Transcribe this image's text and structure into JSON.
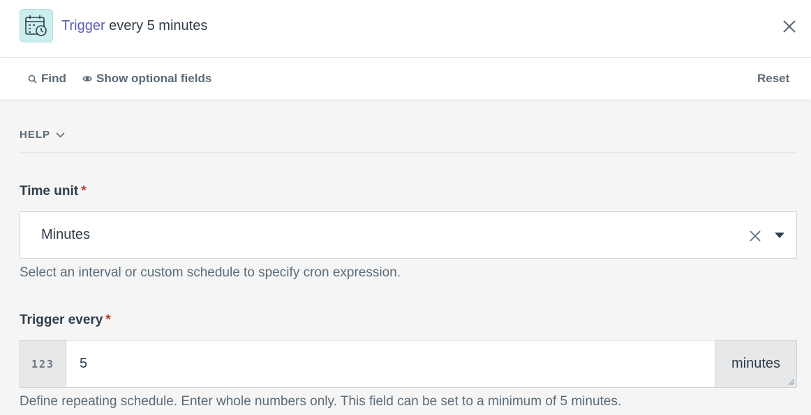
{
  "header": {
    "title_link": "Trigger",
    "title_rest": " every 5 minutes",
    "app_icon": "calendar-clock-icon",
    "close_icon": "close-icon"
  },
  "toolbar": {
    "find_label": "Find",
    "optional_label": "Show optional fields",
    "reset_label": "Reset"
  },
  "help": {
    "label": "HELP"
  },
  "time_unit": {
    "label": "Time unit",
    "required_mark": "*",
    "value": "Minutes",
    "hint": "Select an interval or custom schedule to specify cron expression."
  },
  "trigger_every": {
    "label": "Trigger every",
    "required_mark": "*",
    "prefix": "123",
    "value": "5",
    "suffix": "minutes",
    "hint": "Define repeating schedule. Enter whole numbers only. This field can be set to a minimum of 5 minutes."
  },
  "colors": {
    "accent_link": "#5a5fb0",
    "required": "#c4402d",
    "icon_bg": "#cdeeee"
  }
}
